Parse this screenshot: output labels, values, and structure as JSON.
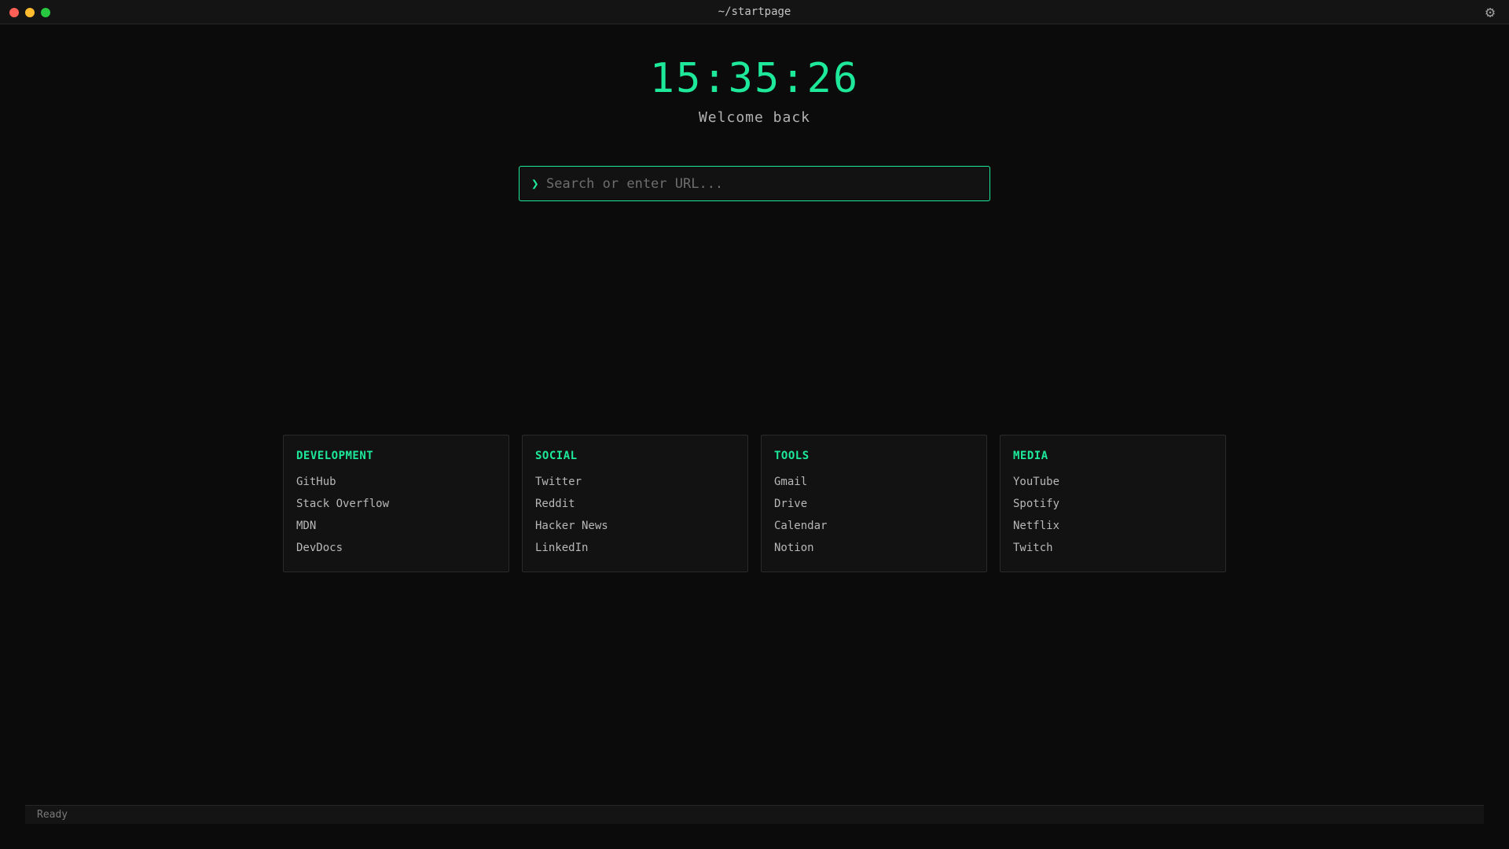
{
  "window": {
    "title": "~/startpage",
    "settings_icon": "⚙"
  },
  "clock": {
    "time": "15:35:26"
  },
  "greeting": "Welcome back",
  "search": {
    "prompt": "❯",
    "placeholder": "Search or enter URL...",
    "value": ""
  },
  "categories": [
    {
      "title": "DEVELOPMENT",
      "links": [
        "GitHub",
        "Stack Overflow",
        "MDN",
        "DevDocs"
      ]
    },
    {
      "title": "SOCIAL",
      "links": [
        "Twitter",
        "Reddit",
        "Hacker News",
        "LinkedIn"
      ]
    },
    {
      "title": "TOOLS",
      "links": [
        "Gmail",
        "Drive",
        "Calendar",
        "Notion"
      ]
    },
    {
      "title": "MEDIA",
      "links": [
        "YouTube",
        "Spotify",
        "Netflix",
        "Twitch"
      ]
    }
  ],
  "status": {
    "text": "Ready"
  },
  "colors": {
    "accent": "#1ee89a",
    "background": "#0b0b0b",
    "card": "#121212"
  }
}
